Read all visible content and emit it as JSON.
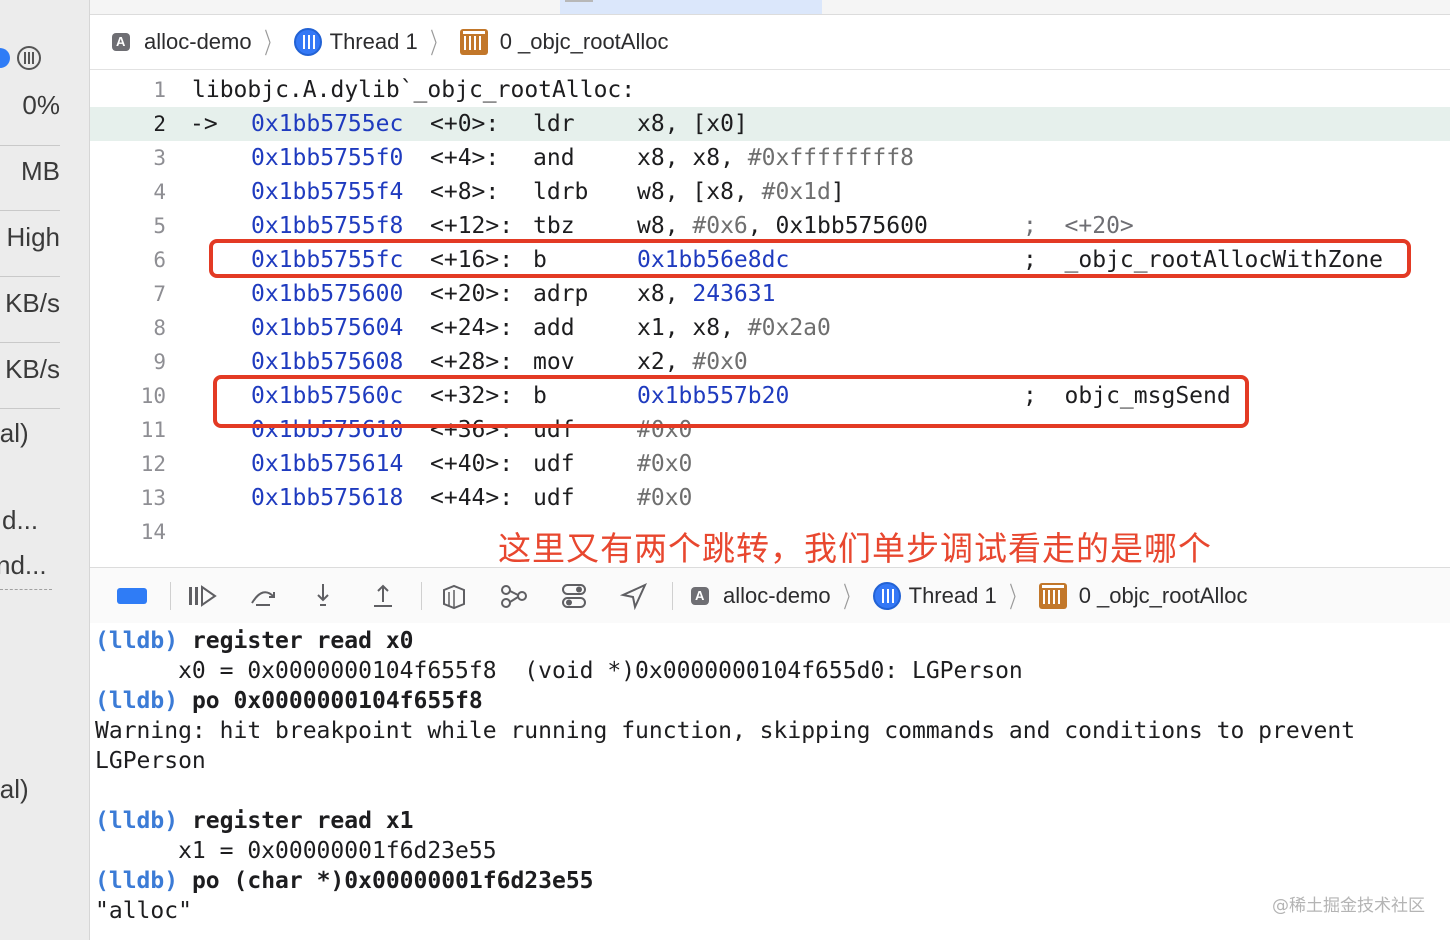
{
  "sidebar": {
    "items": [
      "0%",
      "MB",
      "High",
      "KB/s",
      "KB/s",
      "ial)",
      "d...",
      "nd...",
      "ial)"
    ]
  },
  "breadcrumb_top": {
    "app": "alloc-demo",
    "thread": "Thread 1",
    "frame": "0 _objc_rootAlloc"
  },
  "disassembly": {
    "header": "libobjc.A.dylib`_objc_rootAlloc:",
    "lines": [
      {
        "n": "1"
      },
      {
        "n": "2",
        "arrow": "->",
        "addr": "0x1bb5755ec",
        "off": "<+0>:",
        "mn": "ldr",
        "ops": "x8, [x0]"
      },
      {
        "n": "3",
        "addr": "0x1bb5755f0",
        "off": "<+4>:",
        "mn": "and",
        "ops": "x8, x8, ",
        "imm": "#0xffffffff8"
      },
      {
        "n": "4",
        "addr": "0x1bb5755f4",
        "off": "<+8>:",
        "mn": "ldrb",
        "ops": "w8, [x8, ",
        "imm": "#0x1d",
        "tail": "]"
      },
      {
        "n": "5",
        "addr": "0x1bb5755f8",
        "off": "<+12>:",
        "mn": "tbz",
        "ops": "w8, ",
        "imm": "#0x6",
        "tail": ", 0x1bb575600",
        "cmt": ";  <+20>"
      },
      {
        "n": "6",
        "addr": "0x1bb5755fc",
        "off": "<+16>:",
        "mn": "b",
        "target": "0x1bb56e8dc",
        "cmt": ";  _objc_rootAllocWithZone"
      },
      {
        "n": "7",
        "addr": "0x1bb575600",
        "off": "<+20>:",
        "mn": "adrp",
        "ops": "x8, ",
        "target_inline": "243631"
      },
      {
        "n": "8",
        "addr": "0x1bb575604",
        "off": "<+24>:",
        "mn": "add",
        "ops": "x1, x8, ",
        "imm": "#0x2a0"
      },
      {
        "n": "9",
        "addr": "0x1bb575608",
        "off": "<+28>:",
        "mn": "mov",
        "ops": "x2, ",
        "imm": "#0x0"
      },
      {
        "n": "10",
        "addr": "0x1bb57560c",
        "off": "<+32>:",
        "mn": "b",
        "target": "0x1bb557b20",
        "cmt": ";  objc_msgSend"
      },
      {
        "n": "11",
        "addr": "0x1bb575610",
        "off": "<+36>:",
        "mn": "udf",
        "imm": "#0x0"
      },
      {
        "n": "12",
        "addr": "0x1bb575614",
        "off": "<+40>:",
        "mn": "udf",
        "imm": "#0x0"
      },
      {
        "n": "13",
        "addr": "0x1bb575618",
        "off": "<+44>:",
        "mn": "udf",
        "imm": "#0x0"
      },
      {
        "n": "14"
      }
    ],
    "annotation": "这里又有两个跳转，我们单步调试看走的是哪个"
  },
  "debug_bar": {
    "buttons": [
      "breakpoints-toggle",
      "continue",
      "step-over",
      "step-into",
      "step-out",
      "view-debugger",
      "memory-graph",
      "environment-overrides",
      "simulate-location"
    ],
    "app": "alloc-demo",
    "thread": "Thread 1",
    "frame": "0 _objc_rootAlloc"
  },
  "console": {
    "lines": [
      {
        "prompt": "(lldb)",
        "cmd": "register read x0"
      },
      {
        "text": "      x0 = 0x0000000104f655f8  (void *)0x0000000104f655d0: LGPerson"
      },
      {
        "prompt": "(lldb)",
        "cmd": "po 0x0000000104f655f8"
      },
      {
        "text": "Warning: hit breakpoint while running function, skipping commands and conditions to prevent"
      },
      {
        "text": "LGPerson"
      },
      {
        "text": ""
      },
      {
        "prompt": "(lldb)",
        "cmd": "register read x1"
      },
      {
        "text": "      x1 = 0x00000001f6d23e55"
      },
      {
        "prompt": "(lldb)",
        "cmd": "po (char *)0x00000001f6d23e55"
      },
      {
        "text": "\"alloc\""
      }
    ],
    "watermark": "@稀土掘金技术社区"
  },
  "colors": {
    "accent": "#2f7cf6",
    "address": "#1f3bbf",
    "annotation": "#e8472f",
    "prompt": "#3b7bd6",
    "current_line": "#e6f0ec"
  }
}
